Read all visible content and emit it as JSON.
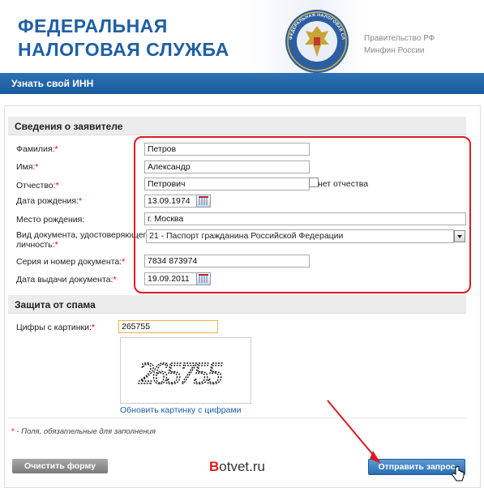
{
  "header": {
    "title_line1": "ФЕДЕРАЛЬНАЯ",
    "title_line2": "НАЛОГОВАЯ СЛУЖБА",
    "gov_line1": "Правительство РФ",
    "gov_line2": "Минфин России",
    "emblem_text": "ФЕДЕРАЛЬНАЯ НАЛОГОВАЯ СЛУЖБА"
  },
  "titlebar": {
    "label": "Узнать свой ИНН"
  },
  "applicant": {
    "heading": "Сведения о заявителе",
    "required_mark": "*",
    "surname_label": "Фамилия:",
    "surname_value": "Петров",
    "name_label": "Имя:",
    "name_value": "Александр",
    "patronymic_label": "Отчество:",
    "patronymic_value": "Петрович",
    "no_patronymic_label": "нет отчества",
    "birthdate_label": "Дата рождения:",
    "birthdate_value": "13.09.1974",
    "birthplace_label": "Место рождения:",
    "birthplace_value": "г. Москва",
    "doc_type_label_line1": "Вид документа, удостоверяющего",
    "doc_type_label_line2": "личность:",
    "doc_type_value": "21 - Паспорт гражданина Российской Федерации",
    "doc_number_label": "Серия и номер документа:",
    "doc_number_value": "7834 873974",
    "doc_date_label": "Дата выдачи документа:",
    "doc_date_value": "19.09.2011"
  },
  "spam": {
    "heading": "Защита от спама",
    "captcha_label": "Цифры с картинки:",
    "captcha_value": "265755",
    "captcha_image_text": "265755",
    "refresh_link": "Обновить картинку с цифрами"
  },
  "note": {
    "mark": "*",
    "text": " - Поля, обязательные для заполнения"
  },
  "buttons": {
    "clear": "Очистить форму",
    "send": "Отправить запрос"
  },
  "watermark": {
    "b": "B",
    "rest": "otvet.ru"
  },
  "colors": {
    "brand_blue": "#1f5fa3",
    "titlebar": "#1a5a9c",
    "highlight": "#d81c23",
    "required": "#dd0000"
  }
}
